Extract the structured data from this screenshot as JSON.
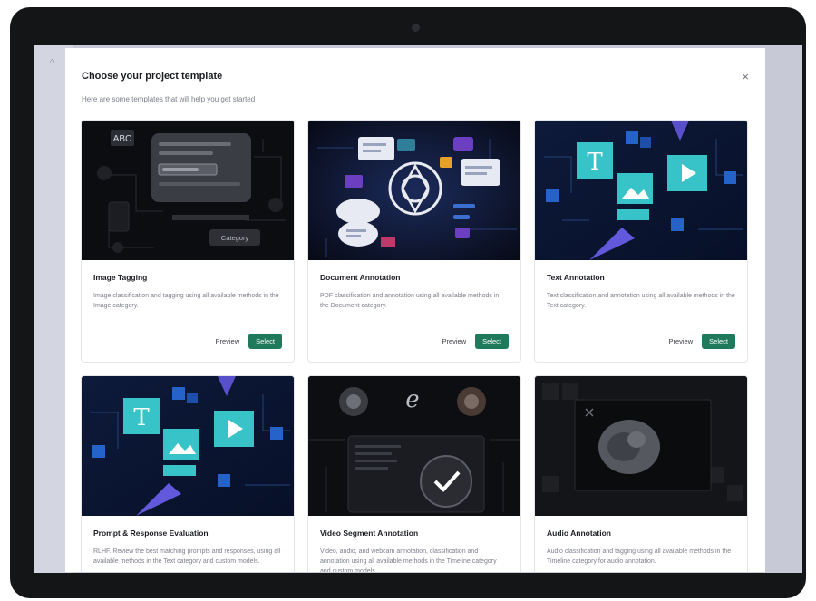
{
  "modal": {
    "title": "Choose your project template",
    "subtitle": "Here are some templates that will help you get started",
    "close_label": "×"
  },
  "templates": [
    {
      "title": "Image Tagging",
      "description": "Image classification and tagging using all available methods in the Image category.",
      "preview_label": "Preview",
      "select_label": "Select",
      "image_labels": {
        "badge": "ABC",
        "category": "Category"
      }
    },
    {
      "title": "Document Annotation",
      "description": "PDF classification and annotation using all available methods in the Document category.",
      "preview_label": "Preview",
      "select_label": "Select"
    },
    {
      "title": "Text Annotation",
      "description": "Text classification and annotation using all available methods in the Text category.",
      "preview_label": "Preview",
      "select_label": "Select",
      "image_labels": {
        "glyph": "T"
      }
    },
    {
      "title": "Prompt & Response Evaluation",
      "description": "RLHF. Review the best matching prompts and responses, using all available methods in the Text category and custom models.",
      "image_labels": {
        "glyph": "T"
      }
    },
    {
      "title": "Video Segment Annotation",
      "description": "Video, audio, and webcam annotation, classification and annotation using all available methods in the Timeline category and custom models."
    },
    {
      "title": "Audio Annotation",
      "description": "Audio classification and tagging using all available methods in the Timeline category for audio annotation."
    }
  ],
  "colors": {
    "accent": "#1f7a5b",
    "device_frame": "#141517",
    "card_image_bg": "#0b0d12",
    "teal_tile": "#37c3c8"
  }
}
